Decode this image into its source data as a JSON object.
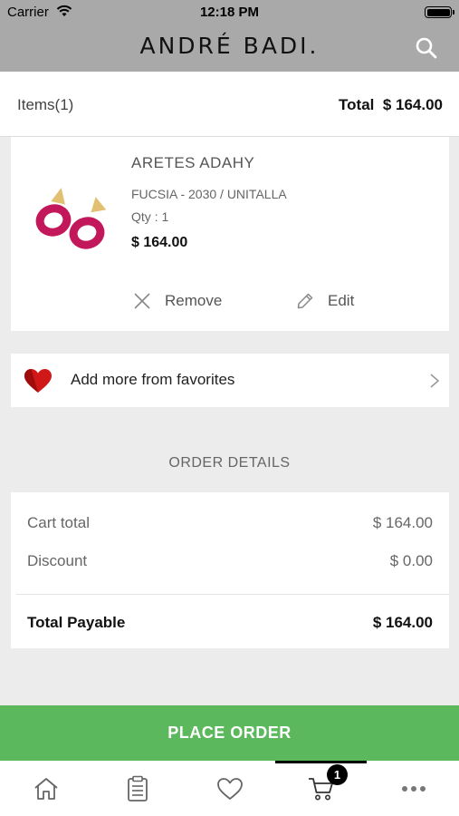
{
  "status_bar": {
    "carrier": "Carrier",
    "time": "12:18 PM"
  },
  "header": {
    "brand": "ANDRÉ BADI."
  },
  "items_bar": {
    "items_label": "Items(1)",
    "total_label": "Total  $ 164.00"
  },
  "cart_item": {
    "name": "ARETES ADAHY",
    "variant": "FUCSIA - 2030 / UNITALLA",
    "qty": "Qty : 1",
    "price": "$ 164.00",
    "remove_label": "Remove",
    "edit_label": "Edit"
  },
  "favorites_row": {
    "label": "Add more from favorites"
  },
  "order_details": {
    "title": "ORDER DETAILS",
    "cart_total_label": "Cart total",
    "cart_total_value": "$ 164.00",
    "discount_label": "Discount",
    "discount_value": "$ 0.00",
    "total_payable_label": "Total Payable",
    "total_payable_value": "$ 164.00"
  },
  "place_order_label": "PLACE ORDER",
  "tab_bar": {
    "tabs": [
      {
        "icon": "home-icon"
      },
      {
        "icon": "clipboard-icon"
      },
      {
        "icon": "heart-icon"
      },
      {
        "icon": "cart-icon",
        "badge": "1",
        "active": true
      },
      {
        "icon": "more-icon"
      }
    ]
  },
  "colors": {
    "accent_green": "#5cb85c",
    "header_gray": "#a9a9a9",
    "product_pink": "#c2185b"
  }
}
